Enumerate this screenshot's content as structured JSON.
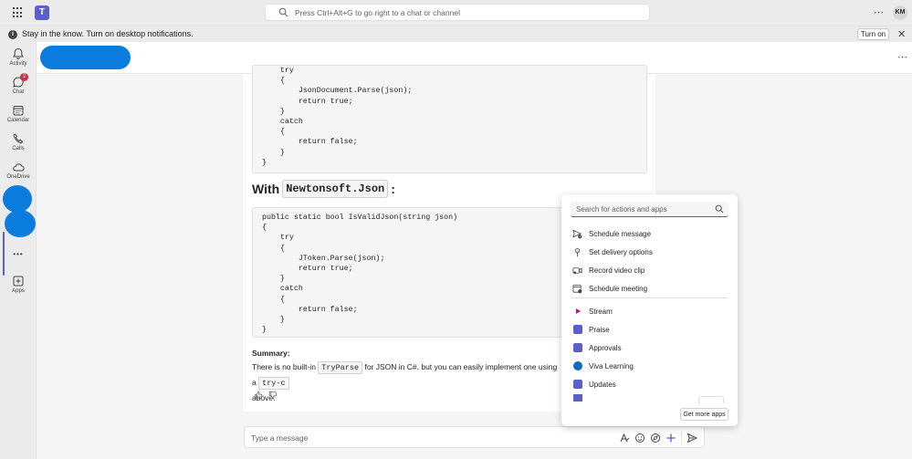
{
  "topbar": {
    "search_placeholder": "Press Ctrl+Alt+G to go right to a chat or channel",
    "more": "⋯",
    "avatar_initials": "KM",
    "teams_logo": "T"
  },
  "notification": {
    "text": "Stay in the know. Turn on desktop notifications.",
    "button": "Turn on",
    "close": "✕"
  },
  "rail": {
    "items": [
      {
        "label": "Activity",
        "icon": "bell-icon"
      },
      {
        "label": "Chat",
        "icon": "chat-icon",
        "badge": "2"
      },
      {
        "label": "Calendar",
        "icon": "calendar-icon"
      },
      {
        "label": "Calls",
        "icon": "phone-icon"
      },
      {
        "label": "OneDrive",
        "icon": "cloud-icon"
      },
      {
        "label": "Apps",
        "icon": "add-apps-icon"
      }
    ],
    "more": "•••"
  },
  "header": {
    "more": "⋯"
  },
  "message": {
    "code1": "    try\n    {\n        JsonDocument.Parse(json);\n        return true;\n    }\n    catch\n    {\n        return false;\n    }\n}",
    "heading_prefix": "With ",
    "heading_code": "Newtonsoft.Json",
    "heading_suffix": ":",
    "code2": "public static bool IsValidJson(string json)\n{\n    try\n    {\n        JToken.Parse(json);\n        return true;\n    }\n    catch\n    {\n        return false;\n    }\n}",
    "summary_title": "Summary:",
    "summary_before": "There is no built-in ",
    "summary_code1": "TryParse",
    "summary_middle": " for JSON in C#. but you can easily implement one using a ",
    "summary_code2": "try-c",
    "summary_after": "above."
  },
  "compose": {
    "placeholder": "Type a message"
  },
  "popup": {
    "search_placeholder": "Search for actions and apps",
    "actions": [
      {
        "label": "Schedule message",
        "icon": "schedule-send-icon"
      },
      {
        "label": "Set delivery options",
        "icon": "delivery-options-icon"
      },
      {
        "label": "Record video clip",
        "icon": "video-clip-icon"
      },
      {
        "label": "Schedule meeting",
        "icon": "calendar-meeting-icon"
      }
    ],
    "apps": [
      {
        "label": "Stream",
        "icon": "stream-icon",
        "color": "#e3008c"
      },
      {
        "label": "Praise",
        "icon": "praise-icon",
        "color": "#5b5fc7"
      },
      {
        "label": "Approvals",
        "icon": "approvals-icon",
        "color": "#5b5fc7"
      },
      {
        "label": "Viva Learning",
        "icon": "viva-learning-icon",
        "color": "#0f6cbd"
      },
      {
        "label": "Updates",
        "icon": "updates-icon",
        "color": "#5b5fc7"
      }
    ],
    "get_more": "Get more apps"
  }
}
